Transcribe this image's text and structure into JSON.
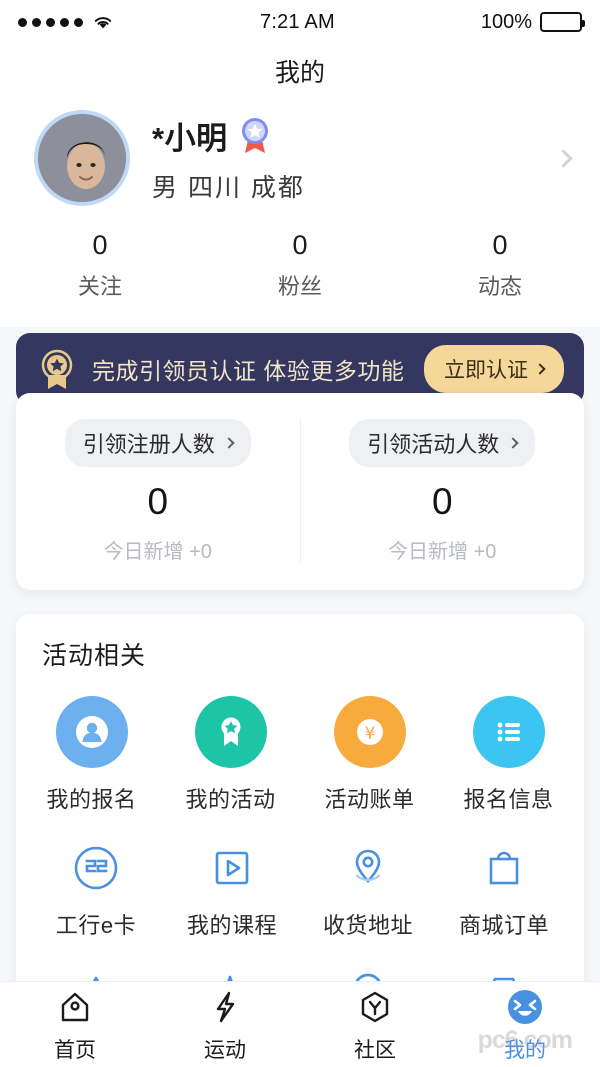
{
  "status_bar": {
    "signal_icon": "signal-dots-icon",
    "wifi_icon": "wifi-icon",
    "time": "7:21 AM",
    "battery_percent": "100%",
    "battery_icon": "battery-full-icon"
  },
  "navbar": {
    "title": "我的"
  },
  "profile": {
    "avatar_icon": "user-avatar",
    "name": "*小明",
    "verified_badge_icon": "medal-badge-icon",
    "meta": "男  四川  成都",
    "chevron_icon": "chevron-right-icon"
  },
  "counters": [
    {
      "value": "0",
      "label": "关注"
    },
    {
      "value": "0",
      "label": "粉丝"
    },
    {
      "value": "0",
      "label": "动态"
    }
  ],
  "certification": {
    "medal_icon": "gold-medal-icon",
    "text": "完成引领员认证 体验更多功能",
    "button_label": "立即认证",
    "button_chevron_icon": "chevron-right-icon",
    "bg_color": "#343760",
    "button_color": "#f5d79a"
  },
  "lead_stats": [
    {
      "pill_label": "引领注册人数",
      "pill_chevron_icon": "chevron-right-icon",
      "value": "0",
      "sub": "今日新增 +0"
    },
    {
      "pill_label": "引领活动人数",
      "pill_chevron_icon": "chevron-right-icon",
      "value": "0",
      "sub": "今日新增 +0"
    }
  ],
  "activity_section": {
    "title": "活动相关",
    "items": [
      {
        "label": "我的报名",
        "icon": "user-circle-icon",
        "color": "#6cb0ef"
      },
      {
        "label": "我的活动",
        "icon": "medal-star-icon",
        "color": "#1ec4a6"
      },
      {
        "label": "活动账单",
        "icon": "yuan-coin-icon",
        "color": "#f7ab3c"
      },
      {
        "label": "报名信息",
        "icon": "list-lines-icon",
        "color": "#3bc5f0"
      }
    ]
  },
  "outline_items": [
    {
      "label": "工行e卡",
      "icon": "icbc-ecard-icon",
      "color": "#4a90e2"
    },
    {
      "label": "我的课程",
      "icon": "play-box-icon",
      "color": "#4a90e2"
    },
    {
      "label": "收货地址",
      "icon": "location-pin-icon",
      "color": "#4a90e2"
    },
    {
      "label": "商城订单",
      "icon": "shopping-bag-icon",
      "color": "#4a90e2"
    }
  ],
  "clipped_items": [
    {
      "icon": "partial-icon-1"
    },
    {
      "icon": "partial-icon-2"
    },
    {
      "icon": "partial-icon-3"
    },
    {
      "icon": "partial-icon-4"
    }
  ],
  "tabbar": {
    "active_color": "#4a90e2",
    "tabs": [
      {
        "label": "首页",
        "icon": "home-icon",
        "active": false
      },
      {
        "label": "运动",
        "icon": "lightning-icon",
        "active": false
      },
      {
        "label": "社区",
        "icon": "hexagon-y-icon",
        "active": false
      },
      {
        "label": "我的",
        "icon": "smiley-face-icon",
        "active": true
      }
    ]
  },
  "watermark": {
    "text": "pc6.com"
  }
}
